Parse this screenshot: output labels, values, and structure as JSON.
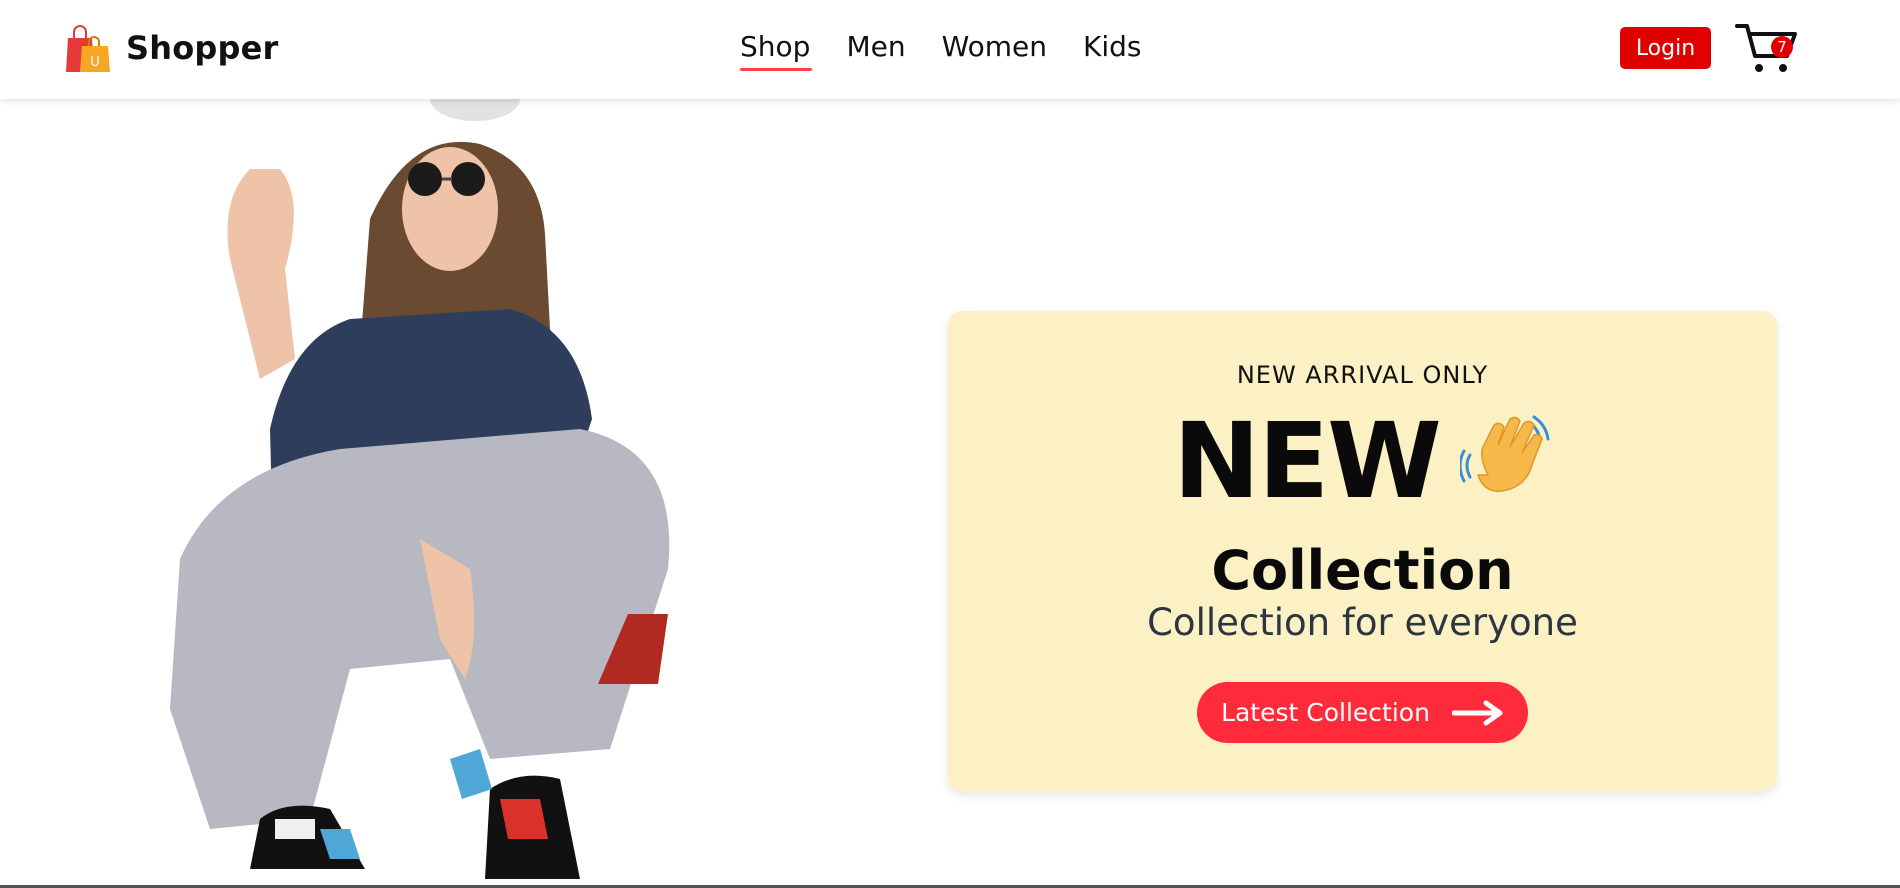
{
  "nav": {
    "brand": {
      "name": "Shopper",
      "icon": "shopping-bags-icon",
      "bag_letter": "U"
    },
    "menu": [
      {
        "label": "Shop",
        "active": true
      },
      {
        "label": "Men",
        "active": false
      },
      {
        "label": "Women",
        "active": false
      },
      {
        "label": "Kids",
        "active": false
      }
    ],
    "login_label": "Login",
    "cart": {
      "icon": "cart-icon",
      "count": "7"
    }
  },
  "hero": {
    "image": "woman-squatting-fashion-photo",
    "eyebrow": "NEW ARRIVAL ONLY",
    "headline": "NEW",
    "headline_icon": "waving-hand-icon",
    "collection": "Collection",
    "subtitle": "Collection for everyone",
    "cta_label": "Latest Collection",
    "cta_icon": "arrow-right-icon"
  },
  "colors": {
    "accent": "#ff4141",
    "login_bg": "#e00000",
    "promo_bg": "#fcf1c5",
    "cta_bg": "#ff2a3a"
  }
}
